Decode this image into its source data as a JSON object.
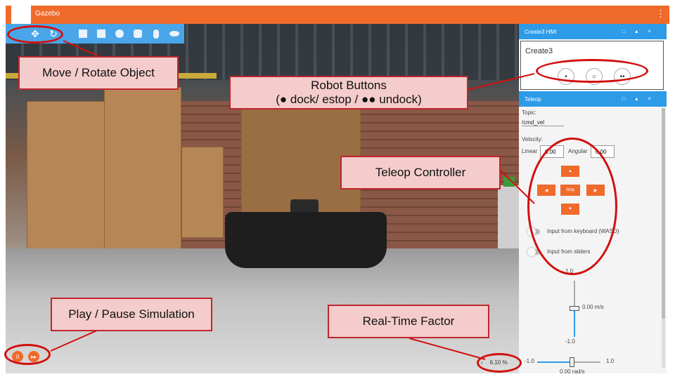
{
  "app": {
    "title": "Gazebo"
  },
  "toolbar": {
    "tools": [
      "move-icon",
      "rotate-icon",
      "box-icon",
      "sphere-icon",
      "cylinder-icon",
      "capsule-icon",
      "ellipsoid-icon"
    ],
    "glyphs": {
      "move": "✥",
      "rotate": "↻"
    }
  },
  "hmi_panel": {
    "title": "Create3 HMI",
    "robot_name": "Create3",
    "buttons": {
      "dock": "•",
      "estop": "○",
      "undock": "••"
    }
  },
  "teleop_panel": {
    "title": "Teleop",
    "topic_label": "Topic:",
    "topic_value": "/cmd_vel",
    "velocity_label": "Velocity:",
    "linear_label": "Linear",
    "linear_value": "0.00",
    "angular_label": "Angular",
    "angular_value": "0.00",
    "up_label": "▲",
    "left_label": "◀",
    "stop_label": "Stop",
    "right_label": "▶",
    "down_label": "▼",
    "keyboard_label": "Input from keyboard (WASD)",
    "sliders_label": "Input from sliders",
    "vert_max": "1.0",
    "vert_value": "0.00 m/s",
    "vert_min": "-1.0",
    "horiz_min": "-1.0",
    "horiz_max": "1.0",
    "horiz_value": "0.00 rad/s"
  },
  "bottom": {
    "play_pause": "II",
    "step": "▸▸",
    "rtf_arrow": "‹",
    "rtf_value": "6.10 %"
  },
  "annotations": {
    "move_rotate": "Move / Rotate Object",
    "robot_buttons_line1": "Robot Buttons",
    "robot_buttons_line2": "(● dock/ estop / ●● undock)",
    "teleop": "Teleop Controller",
    "play_pause": "Play / Pause Simulation",
    "rtf": "Real-Time Factor"
  },
  "colors": {
    "accent_orange": "#f06a2a",
    "panel_blue": "#2d9be8",
    "annotation_fill": "#f4cccc",
    "annotation_border": "#c0262d"
  }
}
